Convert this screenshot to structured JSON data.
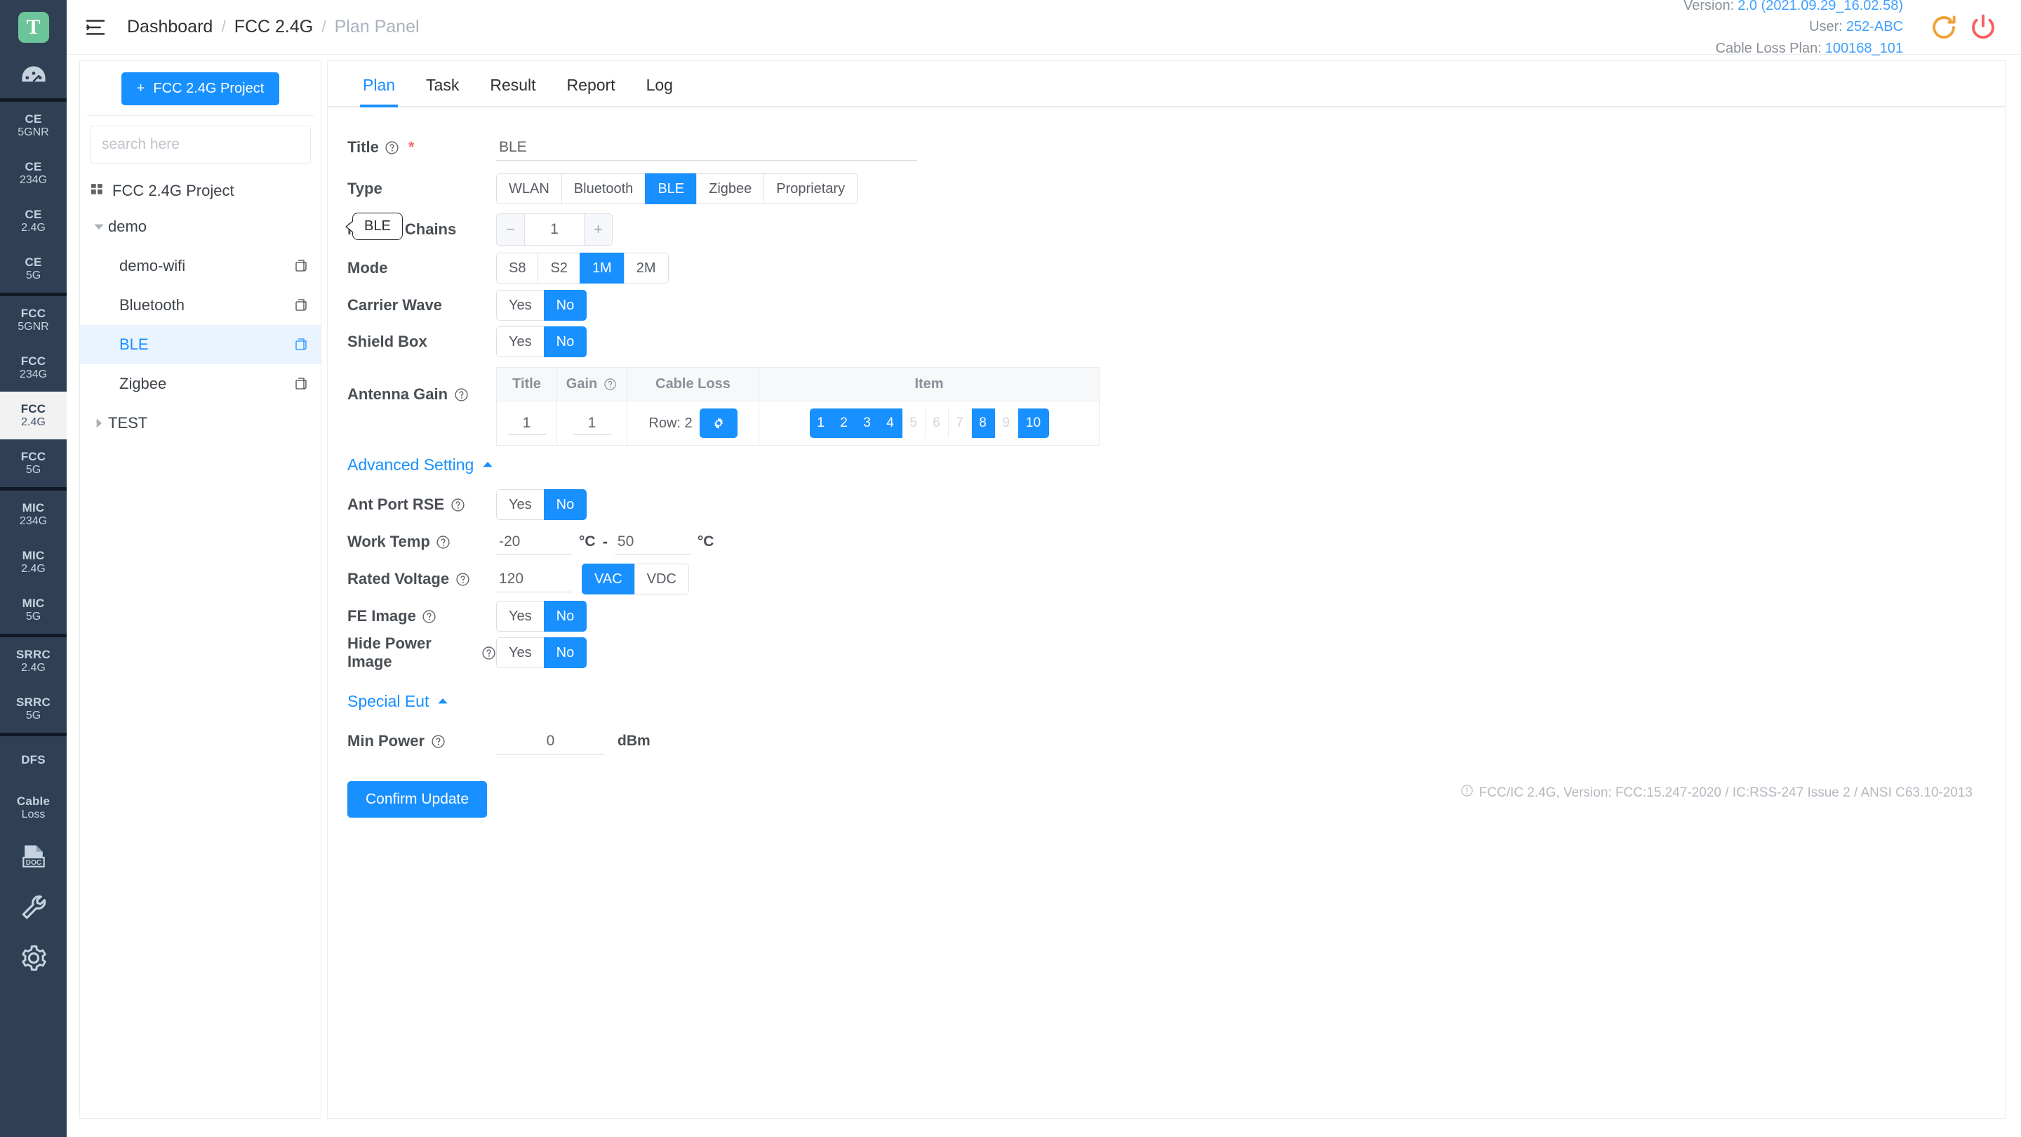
{
  "rail": {
    "logo_letter": "T",
    "gauge_icon": "dashboard-gauge-icon",
    "items": [
      {
        "l1": "CE",
        "l2": "5GNR",
        "active": false
      },
      {
        "l1": "CE",
        "l2": "234G",
        "active": false
      },
      {
        "l1": "CE",
        "l2": "2.4G",
        "active": false
      },
      {
        "l1": "CE",
        "l2": "5G",
        "active": false
      },
      {
        "l1": "FCC",
        "l2": "5GNR",
        "active": false
      },
      {
        "l1": "FCC",
        "l2": "234G",
        "active": false
      },
      {
        "l1": "FCC",
        "l2": "2.4G",
        "active": true
      },
      {
        "l1": "FCC",
        "l2": "5G",
        "active": false
      },
      {
        "l1": "MIC",
        "l2": "234G",
        "active": false
      },
      {
        "l1": "MIC",
        "l2": "2.4G",
        "active": false
      },
      {
        "l1": "MIC",
        "l2": "5G",
        "active": false
      },
      {
        "l1": "SRRC",
        "l2": "2.4G",
        "active": false
      },
      {
        "l1": "SRRC",
        "l2": "5G",
        "active": false
      },
      {
        "l1": "DFS",
        "l2": "",
        "active": false
      },
      {
        "l1": "Cable",
        "l2": "Loss",
        "active": false
      }
    ],
    "bottom_icons": [
      "doc-icon",
      "wrench-icon",
      "gear-icon"
    ]
  },
  "header": {
    "menu_icon": "hamburger-menu-icon",
    "breadcrumb": [
      "Dashboard",
      "FCC 2.4G",
      "Plan Panel"
    ],
    "separator": "/",
    "version_label": "Version:",
    "version_value": "2.0 (2021.09.29_16.02.58)",
    "user_label": "User:",
    "user_value": "252-ABC",
    "cableloss_label": "Cable Loss Plan:",
    "cableloss_value": "100168_101",
    "refresh_icon": "refresh-icon",
    "power_icon": "power-icon",
    "refresh_color": "#f0a135",
    "power_color": "#fa5c5c"
  },
  "tree": {
    "new_project_button": "FCC 2.4G Project",
    "new_project_plus": "+",
    "search_placeholder": "search here",
    "search_value": "",
    "root_label": "FCC 2.4G Project",
    "nodes": [
      {
        "label": "demo",
        "level": 1,
        "expanded": true,
        "selected": false,
        "copy": false
      },
      {
        "label": "demo-wifi",
        "level": 2,
        "expanded": null,
        "selected": false,
        "copy": true
      },
      {
        "label": "Bluetooth",
        "level": 2,
        "expanded": null,
        "selected": false,
        "copy": true
      },
      {
        "label": "BLE",
        "level": 2,
        "expanded": null,
        "selected": true,
        "copy": true
      },
      {
        "label": "Zigbee",
        "level": 2,
        "expanded": null,
        "selected": false,
        "copy": true
      },
      {
        "label": "TEST",
        "level": 1,
        "expanded": false,
        "selected": false,
        "copy": false
      }
    ]
  },
  "tabs": [
    {
      "label": "Plan",
      "active": true
    },
    {
      "label": "Task",
      "active": false
    },
    {
      "label": "Result",
      "active": false
    },
    {
      "label": "Report",
      "active": false
    },
    {
      "label": "Log",
      "active": false
    }
  ],
  "form": {
    "title": {
      "label": "Title",
      "required": "*",
      "value": "BLE"
    },
    "type": {
      "label": "Type",
      "options": [
        "WLAN",
        "Bluetooth",
        "BLE",
        "Zigbee",
        "Proprietary"
      ],
      "selected": "BLE"
    },
    "num_chains": {
      "label": "Num of Chains",
      "value": "1",
      "minus": "−",
      "plus": "+"
    },
    "mode": {
      "label": "Mode",
      "options": [
        "S8",
        "S2",
        "1M",
        "2M"
      ],
      "selected": "1M"
    },
    "carrier_wave": {
      "label": "Carrier Wave",
      "options": [
        "Yes",
        "No"
      ],
      "selected": "No"
    },
    "shield_box": {
      "label": "Shield Box",
      "options": [
        "Yes",
        "No"
      ],
      "selected": "No"
    },
    "antenna_gain": {
      "label": "Antenna Gain",
      "headers": [
        "Title",
        "Gain",
        "Cable Loss",
        "Item"
      ],
      "row": {
        "title": "1",
        "gain": "1",
        "cable_loss_text": "Row: 2",
        "cable_loss_icon": "gear-icon",
        "items": [
          {
            "n": "1",
            "on": true
          },
          {
            "n": "2",
            "on": true
          },
          {
            "n": "3",
            "on": true
          },
          {
            "n": "4",
            "on": true
          },
          {
            "n": "5",
            "on": false
          },
          {
            "n": "6",
            "on": false
          },
          {
            "n": "7",
            "on": false
          },
          {
            "n": "8",
            "on": true
          },
          {
            "n": "9",
            "on": false
          },
          {
            "n": "10",
            "on": true
          }
        ]
      }
    }
  },
  "advanced": {
    "header": "Advanced Setting",
    "collapse_icon": "chevron-up-icon",
    "ant_port_rse": {
      "label": "Ant Port RSE",
      "options": [
        "Yes",
        "No"
      ],
      "selected": "No"
    },
    "work_temp": {
      "label": "Work Temp",
      "min": "-20",
      "max": "50",
      "unit": "°C",
      "dash": "-"
    },
    "rated_voltage": {
      "label": "Rated Voltage",
      "value": "120",
      "options": [
        "VAC",
        "VDC"
      ],
      "selected": "VAC"
    },
    "fe_image": {
      "label": "FE Image",
      "options": [
        "Yes",
        "No"
      ],
      "selected": "No"
    },
    "hide_power_image": {
      "label": "Hide Power Image",
      "options": [
        "Yes",
        "No"
      ],
      "selected": "No"
    }
  },
  "special_eut": {
    "header": "Special Eut",
    "collapse_icon": "chevron-up-icon",
    "min_power": {
      "label": "Min Power",
      "value": "0",
      "unit": "dBm"
    }
  },
  "confirm_button": "Confirm Update",
  "footer_note": "FCC/IC 2.4G, Version: FCC:15.247-2020 / IC:RSS-247 Issue 2 / ANSI C63.10-2013",
  "tooltip": {
    "text": "BLE"
  },
  "colors": {
    "accent": "#1890ff",
    "rail_bg": "#2f4055",
    "rail_sep": "#111a24",
    "selected_row": "#eaf4ff",
    "danger": "#f56c6c"
  }
}
